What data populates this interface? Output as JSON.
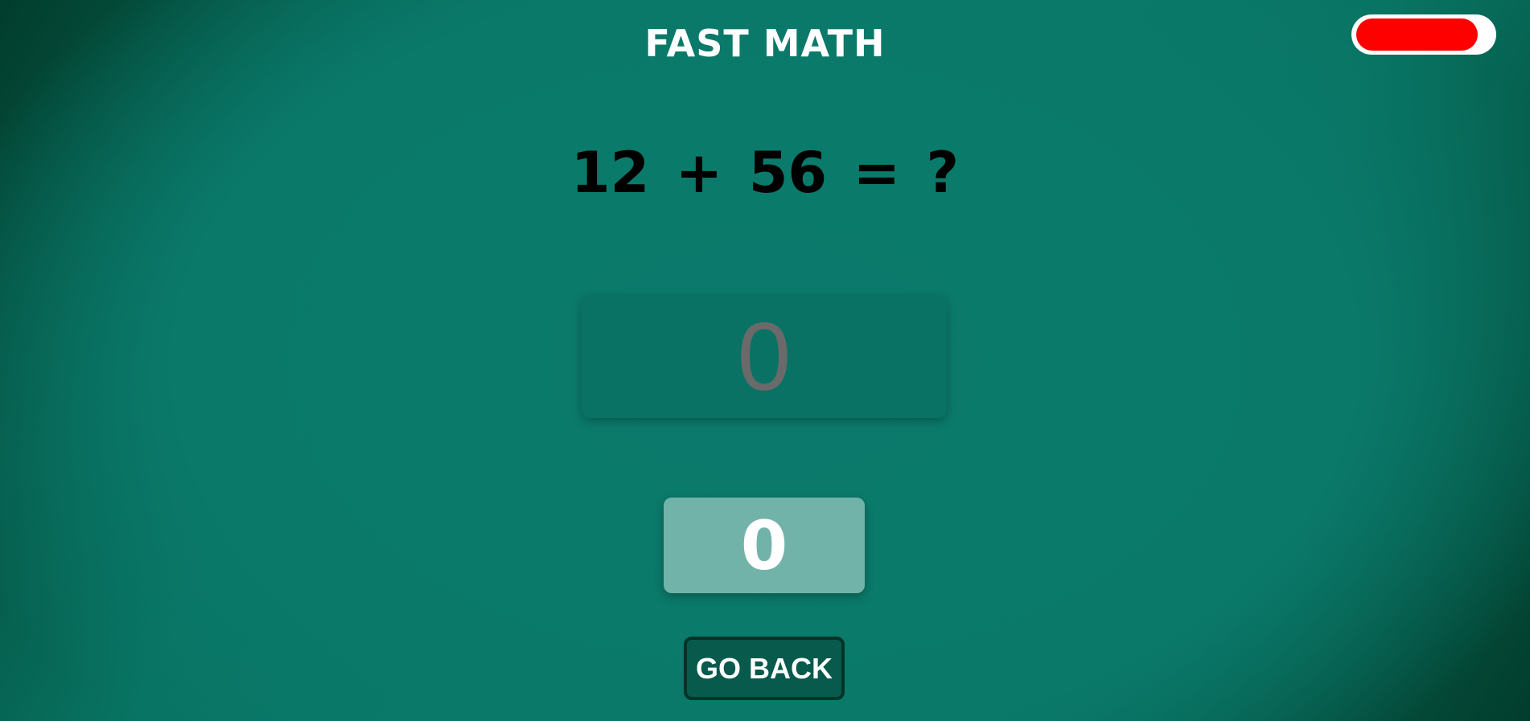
{
  "header": {
    "title": "FAST MATH"
  },
  "timer": {
    "remaining_fraction": 0.9,
    "fill_color": "#ff0000",
    "track_color": "#ffffff"
  },
  "question": {
    "text": "12 + 56 = ?"
  },
  "answer": {
    "value": "",
    "placeholder": "0"
  },
  "score": {
    "value": "0"
  },
  "controls": {
    "go_back_label": "GO BACK"
  }
}
